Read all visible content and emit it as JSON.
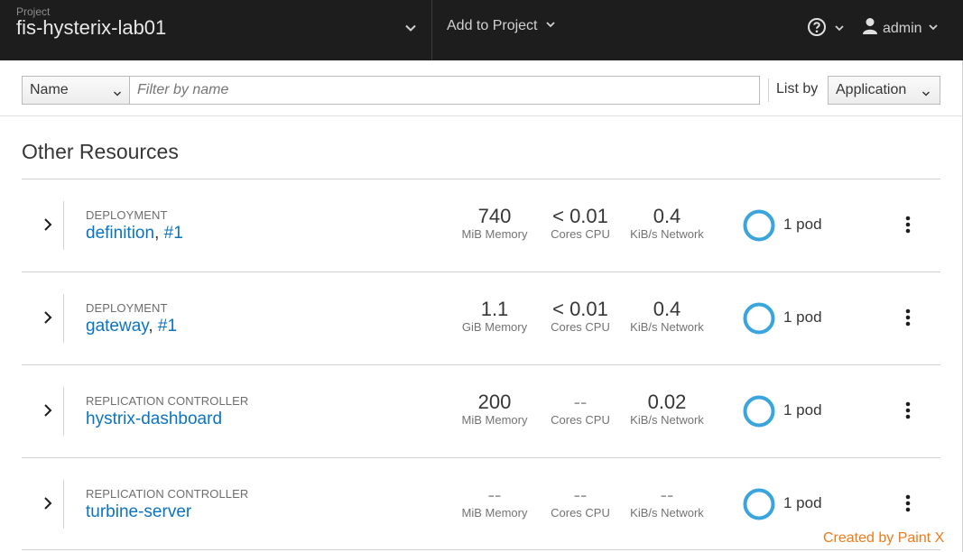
{
  "header": {
    "project_label": "Project",
    "project_name": "fis-hysterix-lab01",
    "add_to_project": "Add to Project",
    "user": "admin"
  },
  "toolbar": {
    "filter_field_value": "Name",
    "filter_placeholder": "Filter by name",
    "list_by_label": "List by",
    "list_by_value": "Application"
  },
  "section_title": "Other Resources",
  "rows": [
    {
      "kind": "DEPLOYMENT",
      "name": "definition",
      "separator": ", ",
      "version": "#1",
      "memory_value": "740",
      "memory_label": "MiB Memory",
      "cpu_value": "< 0.01",
      "cpu_label": "Cores CPU",
      "network_value": "0.4",
      "network_label": "KiB/s Network",
      "pods": "1 pod"
    },
    {
      "kind": "DEPLOYMENT",
      "name": "gateway",
      "separator": ", ",
      "version": "#1",
      "memory_value": "1.1",
      "memory_label": "GiB Memory",
      "cpu_value": "< 0.01",
      "cpu_label": "Cores CPU",
      "network_value": "0.4",
      "network_label": "KiB/s Network",
      "pods": "1 pod"
    },
    {
      "kind": "REPLICATION CONTROLLER",
      "name": "hystrix-dashboard",
      "separator": "",
      "version": "",
      "memory_value": "200",
      "memory_label": "MiB Memory",
      "cpu_value": "--",
      "cpu_label": "Cores CPU",
      "network_value": "0.02",
      "network_label": "KiB/s Network",
      "pods": "1 pod"
    },
    {
      "kind": "REPLICATION CONTROLLER",
      "name": "turbine-server",
      "separator": "",
      "version": "",
      "memory_value": "--",
      "memory_label": "MiB Memory",
      "cpu_value": "--",
      "cpu_label": "Cores CPU",
      "network_value": "--",
      "network_label": "KiB/s Network",
      "pods": "1 pod"
    }
  ],
  "colors": {
    "header_bg": "#1d1d1d",
    "link": "#0b74c2",
    "pod_ring": "#39a5dc"
  },
  "icons": [
    "chevron-down-icon",
    "help-icon",
    "user-icon",
    "chevron-right-icon",
    "pod-donut-icon",
    "kebab-menu-icon"
  ],
  "watermark": "Created by Paint X"
}
